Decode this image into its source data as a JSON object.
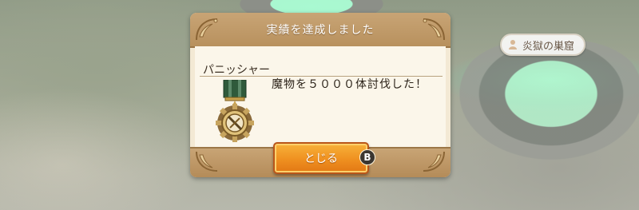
{
  "dialog": {
    "title": "実績を達成しました",
    "achievement_name": "パニッシャー",
    "achievement_desc": "魔物を５０００体討伐した！",
    "close_label": "とじる",
    "close_button_hint": "B",
    "medal_icon": "sword-medal-icon"
  },
  "location": {
    "name": "炎獄の巣窟",
    "icon": "person-marker-icon"
  },
  "colors": {
    "header": "#c8a475",
    "panel": "#f3e9d4",
    "button": "#ef9020"
  }
}
